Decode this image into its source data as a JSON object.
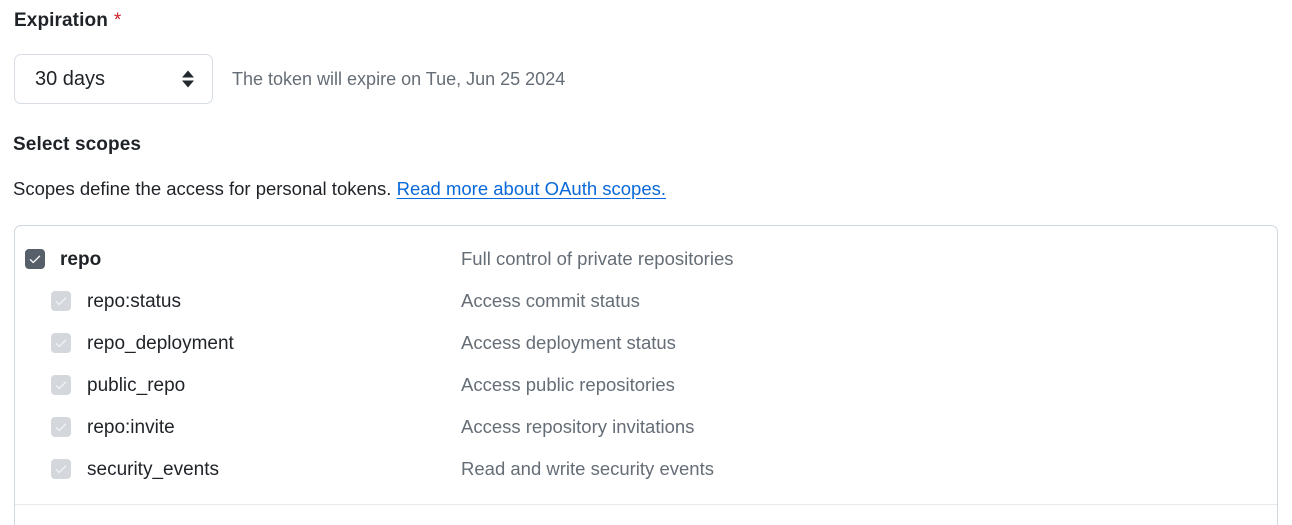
{
  "expiration": {
    "label": "Expiration",
    "required_marker": "*",
    "select_value": "30 days",
    "note": "The token will expire on Tue, Jun 25 2024"
  },
  "scopes": {
    "heading": "Select scopes",
    "description_prefix": "Scopes define the access for personal tokens.",
    "link_text": "Read more about OAuth scopes.",
    "items": [
      {
        "name": "repo",
        "description": "Full control of private repositories",
        "checked": true,
        "disabled": false,
        "level": "parent"
      },
      {
        "name": "repo:status",
        "description": "Access commit status",
        "checked": true,
        "disabled": true,
        "level": "child"
      },
      {
        "name": "repo_deployment",
        "description": "Access deployment status",
        "checked": true,
        "disabled": true,
        "level": "child"
      },
      {
        "name": "public_repo",
        "description": "Access public repositories",
        "checked": true,
        "disabled": true,
        "level": "child"
      },
      {
        "name": "repo:invite",
        "description": "Access repository invitations",
        "checked": true,
        "disabled": true,
        "level": "child"
      },
      {
        "name": "security_events",
        "description": "Read and write security events",
        "checked": true,
        "disabled": true,
        "level": "child"
      }
    ]
  },
  "colors": {
    "link": "#0969da",
    "required": "#cf222e",
    "checkbox_checked": "#57606a",
    "checkbox_disabled": "#d4d8dd",
    "muted_text": "#656d76",
    "border": "#d0d7de"
  }
}
